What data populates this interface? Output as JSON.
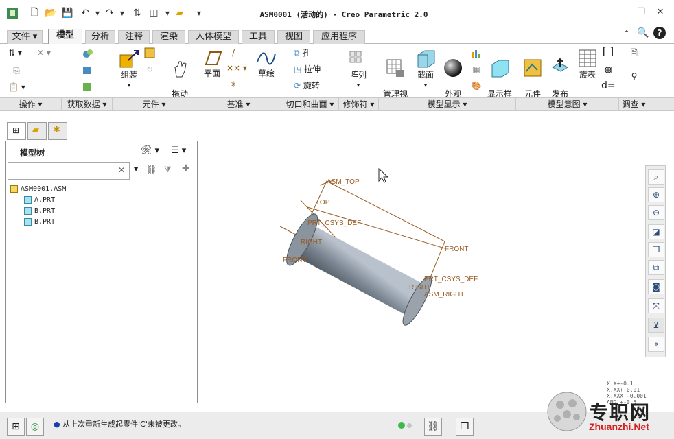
{
  "window": {
    "title": "ASM0001 (活动的) - Creo Parametric 2.0"
  },
  "tabs": [
    {
      "label": "文件",
      "active": false
    },
    {
      "label": "模型",
      "active": true
    },
    {
      "label": "分析",
      "active": false
    },
    {
      "label": "注释",
      "active": false
    },
    {
      "label": "渲染",
      "active": false
    },
    {
      "label": "人体模型",
      "active": false
    },
    {
      "label": "工具",
      "active": false
    },
    {
      "label": "视图",
      "active": false
    },
    {
      "label": "应用程序",
      "active": false
    }
  ],
  "ribbon": {
    "assemble": "组装",
    "drag": "拖动\n元件",
    "plane": "平面",
    "sketch": "草绘",
    "hole": "孔",
    "extrude": "拉伸",
    "revolve": "旋转",
    "pattern": "阵列",
    "manage_view": "管理视\n图",
    "section": "截面",
    "appearance": "外观\n库",
    "display_style": "显示样\n式",
    "comp_interface": "元件\n界面",
    "publish_geom": "发布\n几何",
    "family_table": "族表",
    "groups": [
      "操作",
      "获取数据",
      "元件",
      "基准",
      "切口和曲面",
      "修饰符",
      "模型显示",
      "模型意图",
      "调查"
    ]
  },
  "model_tree": {
    "title": "模型树",
    "search_value": "",
    "items": [
      {
        "label": "ASM0001.ASM",
        "level": 0
      },
      {
        "label": "A.PRT",
        "level": 1
      },
      {
        "label": "B.PRT",
        "level": 1
      },
      {
        "label": "B.PRT",
        "level": 1
      }
    ]
  },
  "viewport": {
    "labels": {
      "asm_top": "ASM_TOP",
      "top": "TOP",
      "csys_def": "PRT_CSYS_DEF",
      "right_l": "RIGHT",
      "front_l": "FRONT",
      "front_r": "FRONT",
      "prt_csys": "PRT_CSYS_DEF",
      "right_r": "RIGHT",
      "asm_right": "ASM_RIGHT"
    },
    "coords": [
      "X.X+-0.1",
      "X.XX+-0.01",
      "X.XXX+-0.001",
      "ANG +-0.5"
    ]
  },
  "status": {
    "message": "从上次重新生成起零件'C'未被更改。"
  },
  "watermark": {
    "cn": "专职网",
    "url": "Zhuanzhi.Net"
  },
  "colors": {
    "ribbon_accent": "#f0b000",
    "datum": "#9a5a20",
    "part": "#6f7a86"
  }
}
